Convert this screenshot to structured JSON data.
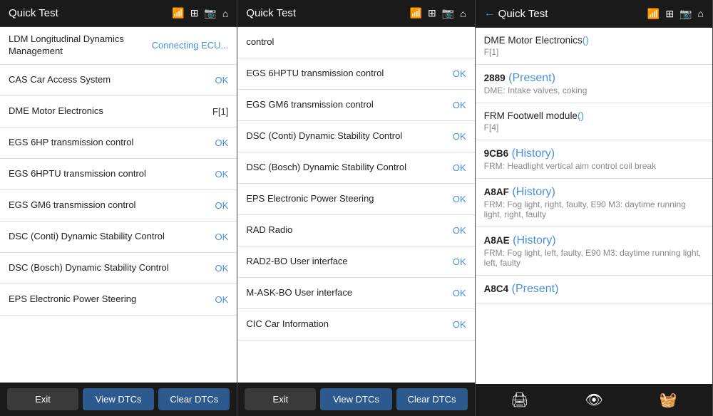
{
  "panels": [
    {
      "id": "panel1",
      "header": {
        "title": "Quick Test",
        "has_back": false
      },
      "rows": [
        {
          "label": "LDM Longitudinal Dynamics Management",
          "status": "Connecting ECU...",
          "status_class": "status-connecting"
        },
        {
          "label": "CAS Car Access System",
          "status": "OK",
          "status_class": "status-ok"
        },
        {
          "label": "DME Motor Electronics",
          "status": "F[1]",
          "status_class": "status-f"
        },
        {
          "label": "EGS 6HP transmission control",
          "status": "OK",
          "status_class": "status-ok"
        },
        {
          "label": "EGS 6HPTU transmission control",
          "status": "OK",
          "status_class": "status-ok"
        },
        {
          "label": "EGS GM6 transmission control",
          "status": "OK",
          "status_class": "status-ok"
        },
        {
          "label": "DSC (Conti) Dynamic Stability Control",
          "status": "OK",
          "status_class": "status-ok"
        },
        {
          "label": "DSC (Bosch) Dynamic Stability Control",
          "status": "OK",
          "status_class": "status-ok"
        },
        {
          "label": "EPS Electronic Power Steering",
          "status": "OK",
          "status_class": "status-ok"
        }
      ],
      "footer": [
        {
          "label": "Exit",
          "class": "footer-btn-exit",
          "name": "exit-btn-1"
        },
        {
          "label": "View DTCs",
          "class": "",
          "name": "view-dtcs-btn-1"
        },
        {
          "label": "Clear DTCs",
          "class": "",
          "name": "clear-dtcs-btn-1"
        }
      ]
    },
    {
      "id": "panel2",
      "header": {
        "title": "Quick Test",
        "has_back": false
      },
      "rows": [
        {
          "label": "control",
          "status": "",
          "status_class": ""
        },
        {
          "label": "EGS 6HPTU transmission control",
          "status": "OK",
          "status_class": "status-ok"
        },
        {
          "label": "EGS GM6 transmission control",
          "status": "OK",
          "status_class": "status-ok"
        },
        {
          "label": "DSC (Conti) Dynamic Stability Control",
          "status": "OK",
          "status_class": "status-ok"
        },
        {
          "label": "DSC (Bosch) Dynamic Stability Control",
          "status": "OK",
          "status_class": "status-ok"
        },
        {
          "label": "EPS Electronic Power Steering",
          "status": "OK",
          "status_class": "status-ok"
        },
        {
          "label": "RAD Radio",
          "status": "OK",
          "status_class": "status-ok"
        },
        {
          "label": "RAD2-BO User interface",
          "status": "OK",
          "status_class": "status-ok"
        },
        {
          "label": "M-ASK-BO User interface",
          "status": "OK",
          "status_class": "status-ok"
        },
        {
          "label": "CIC Car Information",
          "status": "OK",
          "status_class": "status-ok"
        }
      ],
      "footer": [
        {
          "label": "Exit",
          "class": "footer-btn-exit",
          "name": "exit-btn-2"
        },
        {
          "label": "View DTCs",
          "class": "",
          "name": "view-dtcs-btn-2"
        },
        {
          "label": "Clear DTCs",
          "class": "",
          "name": "clear-dtcs-btn-2"
        }
      ]
    },
    {
      "id": "panel3",
      "header": {
        "title": "Quick Test",
        "has_back": true
      },
      "detail_items": [
        {
          "type": "module",
          "title": "DME Motor Electronics",
          "status_text": "()",
          "status_class": "",
          "subtitle": "F[1]"
        },
        {
          "type": "code",
          "code": "2889",
          "status_text": "Present",
          "status_class": "status-present",
          "desc": "DME: Intake valves, coking"
        },
        {
          "type": "module",
          "title": "FRM Footwell module",
          "status_text": "()",
          "status_class": "",
          "subtitle": "F[4]"
        },
        {
          "type": "code",
          "code": "9CB6",
          "status_text": "History",
          "status_class": "status-history",
          "desc": "FRM: Headlight vertical aim control coil break"
        },
        {
          "type": "code",
          "code": "A8AF",
          "status_text": "History",
          "status_class": "status-history",
          "desc": "FRM: Fog light, right, faulty, E90 M3: daytime running light, right, faulty"
        },
        {
          "type": "code",
          "code": "A8AE",
          "status_text": "History",
          "status_class": "status-history",
          "desc": "FRM: Fog light, left, faulty, E90 M3: daytime running light, left, faulty"
        },
        {
          "type": "code",
          "code": "A8C4",
          "status_text": "Present",
          "status_class": "status-present",
          "desc": ""
        }
      ]
    }
  ]
}
